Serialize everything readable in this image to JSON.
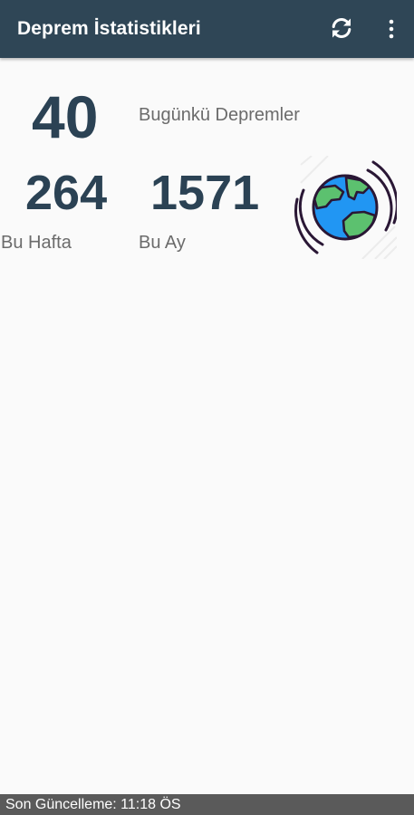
{
  "app_bar": {
    "title": "Deprem İstatistikleri",
    "refresh_icon": "refresh-icon",
    "menu_icon": "more-vert-icon"
  },
  "stats": {
    "today": {
      "value": "40",
      "label": "Bugünkü Depremler"
    },
    "week": {
      "value": "264",
      "label": "Bu Hafta"
    },
    "month": {
      "value": "1571",
      "label": "Bu Ay"
    }
  },
  "illustration": {
    "icon": "earth-globe-icon"
  },
  "status_bar": {
    "text": "Son Güncelleme: 11:18 ÖS"
  },
  "colors": {
    "app_bar": "#2f4656",
    "numbers": "#2b4254",
    "status_bar": "#5a5a5a",
    "ocean": "#2196f3",
    "land": "#5cc16f"
  }
}
